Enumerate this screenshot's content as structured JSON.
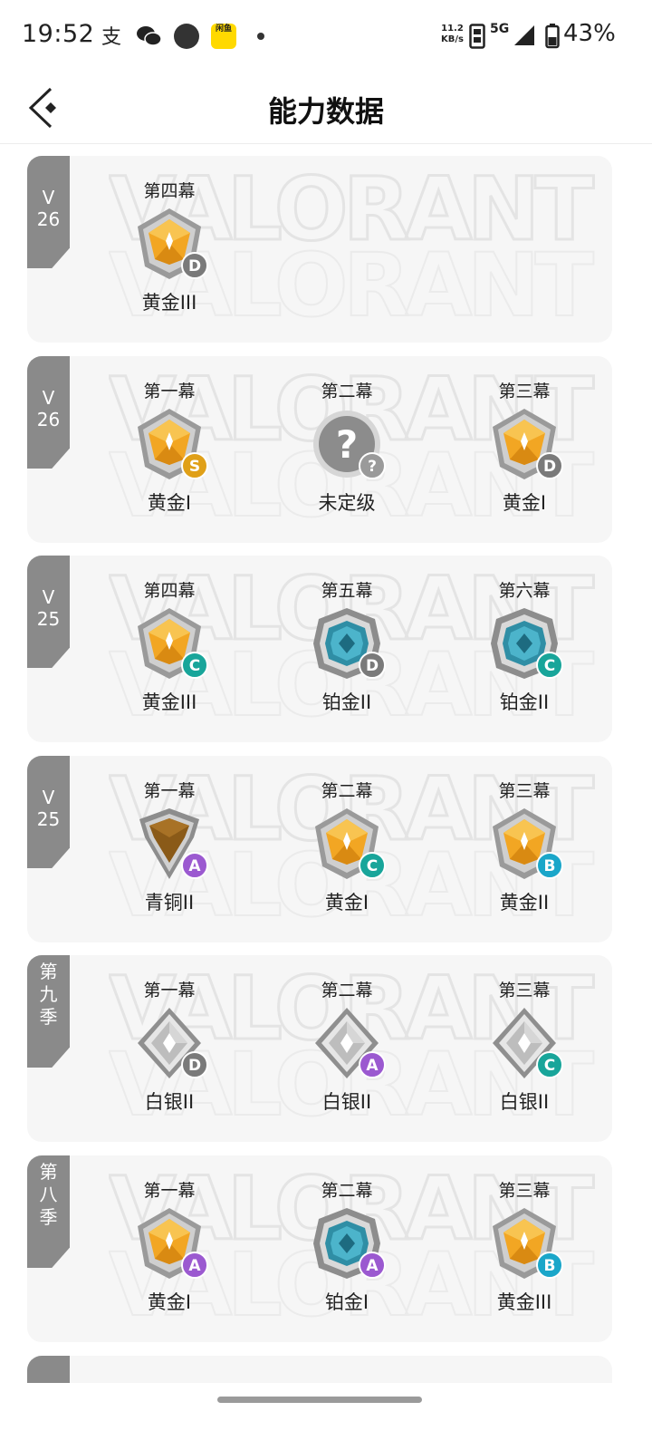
{
  "status_bar": {
    "time": "19:52",
    "net_speed_value": "11.2",
    "net_speed_unit": "KB/s",
    "network": "5G",
    "battery": "43%",
    "app_icon_text": "闲鱼"
  },
  "header": {
    "title": "能力数据"
  },
  "colors": {
    "grade_S": "#e0a018",
    "grade_A": "#9b59d0",
    "grade_B": "#1aa6c9",
    "grade_C": "#18a59a",
    "grade_D": "#7a7a7a",
    "grade_unknown": "#9a9a9a",
    "tag_bg": "#8a8a8a",
    "card_bg": "#f6f6f6"
  },
  "seasons": [
    {
      "tag": "V 26",
      "acts": [
        {
          "act": "第四幕",
          "rank": "黄金III",
          "tier": "gold",
          "grade": "D"
        }
      ]
    },
    {
      "tag": "V 26",
      "acts": [
        {
          "act": "第一幕",
          "rank": "黄金I",
          "tier": "gold",
          "grade": "S"
        },
        {
          "act": "第二幕",
          "rank": "未定级",
          "tier": "unranked",
          "grade": "?"
        },
        {
          "act": "第三幕",
          "rank": "黄金I",
          "tier": "gold",
          "grade": "D"
        }
      ]
    },
    {
      "tag": "V 25",
      "acts": [
        {
          "act": "第四幕",
          "rank": "黄金III",
          "tier": "gold",
          "grade": "C"
        },
        {
          "act": "第五幕",
          "rank": "铂金II",
          "tier": "platinum",
          "grade": "D"
        },
        {
          "act": "第六幕",
          "rank": "铂金II",
          "tier": "platinum",
          "grade": "C"
        }
      ]
    },
    {
      "tag": "V 25",
      "acts": [
        {
          "act": "第一幕",
          "rank": "青铜II",
          "tier": "bronze",
          "grade": "A"
        },
        {
          "act": "第二幕",
          "rank": "黄金I",
          "tier": "gold",
          "grade": "C"
        },
        {
          "act": "第三幕",
          "rank": "黄金II",
          "tier": "gold",
          "grade": "B"
        }
      ]
    },
    {
      "tag": "第九季",
      "acts": [
        {
          "act": "第一幕",
          "rank": "白银II",
          "tier": "silver",
          "grade": "D"
        },
        {
          "act": "第二幕",
          "rank": "白银II",
          "tier": "silver",
          "grade": "A"
        },
        {
          "act": "第三幕",
          "rank": "白银II",
          "tier": "silver",
          "grade": "C"
        }
      ]
    },
    {
      "tag": "第八季",
      "acts": [
        {
          "act": "第一幕",
          "rank": "黄金I",
          "tier": "gold",
          "grade": "A"
        },
        {
          "act": "第二幕",
          "rank": "铂金I",
          "tier": "platinum",
          "grade": "A"
        },
        {
          "act": "第三幕",
          "rank": "黄金III",
          "tier": "gold",
          "grade": "B"
        }
      ]
    }
  ]
}
